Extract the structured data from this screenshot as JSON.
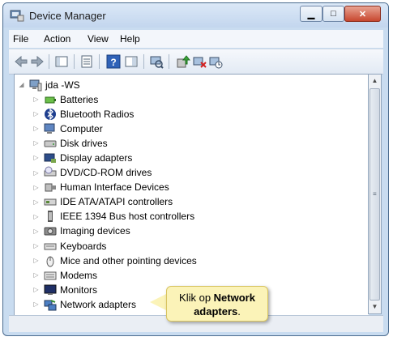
{
  "window": {
    "title": "Device Manager"
  },
  "menu": [
    "File",
    "Action",
    "View",
    "Help"
  ],
  "tree": {
    "root": "jda -WS",
    "items": [
      {
        "label": "Batteries",
        "icon": "battery-icon"
      },
      {
        "label": "Bluetooth Radios",
        "icon": "bluetooth-icon"
      },
      {
        "label": "Computer",
        "icon": "computer-icon"
      },
      {
        "label": "Disk drives",
        "icon": "disk-drive-icon"
      },
      {
        "label": "Display adapters",
        "icon": "display-adapter-icon"
      },
      {
        "label": "DVD/CD-ROM drives",
        "icon": "dvd-drive-icon"
      },
      {
        "label": "Human Interface Devices",
        "icon": "hid-icon"
      },
      {
        "label": "IDE ATA/ATAPI controllers",
        "icon": "ide-controller-icon"
      },
      {
        "label": "IEEE 1394 Bus host controllers",
        "icon": "ieee1394-icon"
      },
      {
        "label": "Imaging devices",
        "icon": "camera-icon"
      },
      {
        "label": "Keyboards",
        "icon": "keyboard-icon"
      },
      {
        "label": "Mice and other pointing devices",
        "icon": "mouse-icon"
      },
      {
        "label": "Modems",
        "icon": "modem-icon"
      },
      {
        "label": "Monitors",
        "icon": "monitor-icon"
      },
      {
        "label": "Network adapters",
        "icon": "network-adapter-icon"
      }
    ]
  },
  "callout": {
    "prefix": "Klik op ",
    "bold_1": "Network",
    "bold_2": "adapters",
    "suffix": "."
  },
  "colors": {
    "titlebar": "#c9dcf0",
    "close_button": "#c7472f",
    "callout": "#fbf3b8"
  }
}
